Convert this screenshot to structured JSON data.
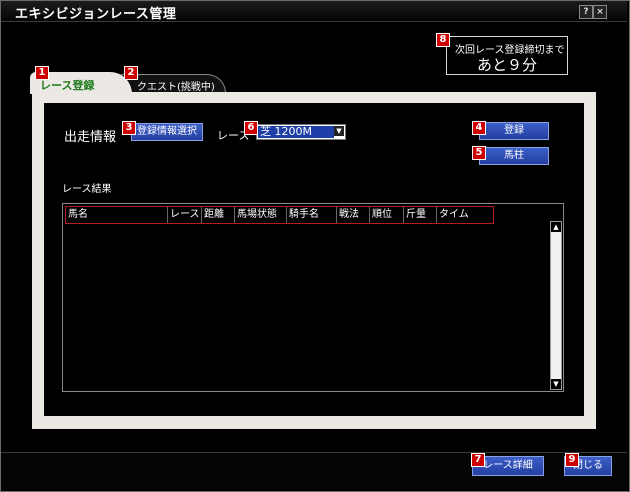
{
  "window": {
    "title": "エキシビジョンレース管理",
    "help_label": "?",
    "close_label": "×"
  },
  "markers": [
    "1",
    "2",
    "3",
    "4",
    "5",
    "6",
    "7",
    "8",
    "9"
  ],
  "deadline": {
    "label": "次回レース登録締切まで",
    "value": "あと９分"
  },
  "tabs": [
    {
      "label": "レース登録",
      "active": true
    },
    {
      "label": "クエスト(挑戦中)",
      "active": false
    }
  ],
  "entry": {
    "heading": "出走情報",
    "select_button": "登録情報選択",
    "race_label": "レース",
    "race_value": "芝 1200M"
  },
  "actions": {
    "register": "登録",
    "umabashira": "馬柱"
  },
  "results": {
    "heading": "レース結果",
    "columns": [
      "馬名",
      "レース",
      "距離",
      "馬場状態",
      "騎手名",
      "戦法",
      "順位",
      "斤量",
      "タイム"
    ],
    "rows": []
  },
  "footer": {
    "details_button": "レース詳細",
    "close_button": "閉じる"
  },
  "colors": {
    "accent_blue": "#2f4fb8",
    "marker_red": "#cc0000",
    "tab_active_text": "#1d7a1d",
    "frame": "#ece9e4"
  }
}
